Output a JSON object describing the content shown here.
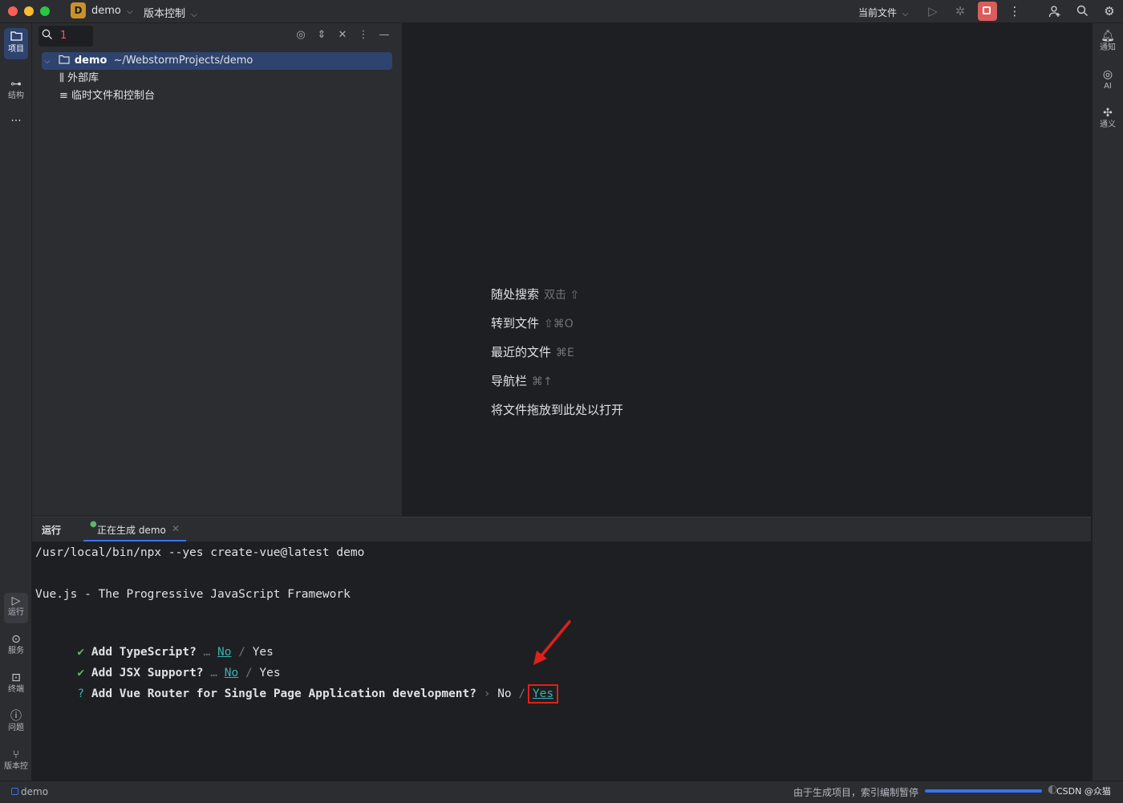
{
  "titlebar": {
    "project_badge": "D",
    "project_name": "demo",
    "vcs_menu": "版本控制",
    "run_config": "当前文件"
  },
  "left_strip": {
    "project_label": "项目",
    "structure_label": "结构",
    "more": "···",
    "run_label": "运行",
    "services_label": "服务",
    "terminal_label": "终端",
    "problems_label": "问题",
    "vcs_label": "版本控"
  },
  "right_strip": {
    "notifications_label": "通知",
    "ai_label": "AI",
    "tongyi_label": "通义"
  },
  "project_panel": {
    "search_value": "1",
    "tree": [
      {
        "name": "demo",
        "path": "~/WebstormProjects/demo"
      },
      {
        "name": "外部库"
      },
      {
        "name": "临时文件和控制台"
      }
    ]
  },
  "editor_hints": [
    {
      "label": "随处搜索",
      "key": "双击 ⇧"
    },
    {
      "label": "转到文件",
      "key": "⇧⌘O"
    },
    {
      "label": "最近的文件",
      "key": "⌘E"
    },
    {
      "label": "导航栏",
      "key": "⌘↑"
    },
    {
      "label": "将文件拖放到此处以打开",
      "key": ""
    }
  ],
  "run_panel": {
    "title": "运行",
    "tab_label": "正在生成 demo",
    "console": {
      "command": "/usr/local/bin/npx --yes create-vue@latest demo",
      "banner": "Vue.js - The Progressive JavaScript Framework",
      "prompts": [
        {
          "mark": "✔",
          "question": "Add TypeScript?",
          "sep": "…",
          "no": "No",
          "slash": "/",
          "yes": "Yes"
        },
        {
          "mark": "✔",
          "question": "Add JSX Support?",
          "sep": "…",
          "no": "No",
          "slash": "/",
          "yes": "Yes"
        },
        {
          "mark": "?",
          "question": "Add Vue Router for Single Page Application development?",
          "sep": "›",
          "no": "No",
          "slash": "/",
          "yes": "Yes"
        }
      ]
    }
  },
  "statusbar": {
    "project": "demo",
    "indexing_message": "由于生成项目，索引编制暂停",
    "watermark": "CSDN @众猫"
  },
  "colors": {
    "accent": "#3574f0",
    "selection": "#2e436e",
    "stop": "#db5c5c",
    "annotation_red": "#e0201c",
    "link_teal": "#3bb0b0"
  }
}
